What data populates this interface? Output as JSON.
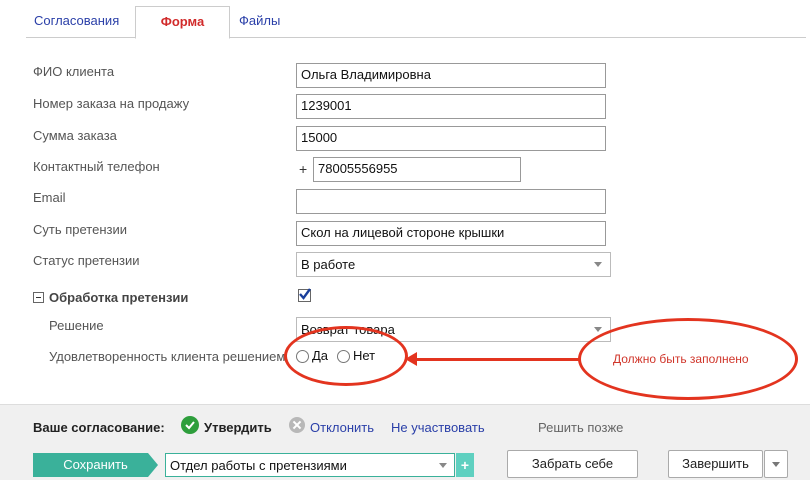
{
  "tabs": [
    {
      "label": "Согласования"
    },
    {
      "label": "Форма"
    },
    {
      "label": "Файлы"
    }
  ],
  "form": {
    "client_name_label": "ФИО клиента",
    "client_name_value": "Ольга Владимировна",
    "order_number_label": "Номер заказа на продажу",
    "order_number_value": "1239001",
    "order_sum_label": "Сумма заказа",
    "order_sum_value": "15000",
    "phone_label": "Контактный телефон",
    "phone_prefix": "+",
    "phone_value": "78005556955",
    "email_label": "Email",
    "email_value": "",
    "claim_label": "Суть претензии",
    "claim_value": "Скол на лицевой стороне крышки",
    "status_label": "Статус претензии",
    "status_value": "В работе",
    "section_title": "Обработка претензии",
    "section_checked": true,
    "decision_label": "Решение",
    "decision_value": "Возврат товара",
    "satisfaction_label": "Удовлетворенность клиента решением",
    "radio_yes": "Да",
    "radio_no": "Нет",
    "validation_message": "Должно быть заполнено"
  },
  "bottom": {
    "approval_label": "Ваше согласование:",
    "approve": "Утвердить",
    "reject": "Отклонить",
    "abstain": "Не участвовать",
    "later": "Решить позже",
    "save": "Сохранить",
    "department": "Отдел работы с претензиями",
    "dept_add": "+",
    "take": "Забрать себе",
    "finish": "Завершить"
  },
  "colors": {
    "accent_teal": "#3ab19a",
    "link_blue": "#2a3fa8",
    "error_red": "#e3341f",
    "approve_green": "#2e9e3c"
  }
}
